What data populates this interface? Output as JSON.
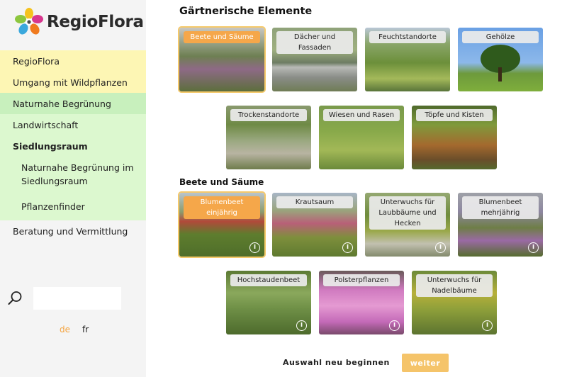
{
  "sidebar": {
    "logo_text": "RegioFlora",
    "nav": {
      "regioflora": "RegioFlora",
      "umgang": "Umgang mit Wildpflanzen",
      "naturnahe": "Naturnahe Begrünung",
      "landwirtschaft": "Landwirtschaft",
      "siedlungsraum": "Siedlungsraum",
      "sub": [
        "Naturnahe Begrünung im Siedlungsraum",
        "Pflanzenfinder"
      ],
      "beratung": "Beratung und Vermittlung"
    },
    "search_placeholder": "",
    "languages": [
      "de",
      "fr"
    ],
    "active_language": "de",
    "colors": {
      "accent": "#f5a542",
      "yellow": "#fdf6b4",
      "green": "#c8f0bd",
      "light_green": "#dcf8cf"
    }
  },
  "main": {
    "title": "Gärtnerische Elemente",
    "elements": [
      {
        "label": "Beete und Säume",
        "selected": true
      },
      {
        "label": "Dächer und Fassaden",
        "selected": false
      },
      {
        "label": "Feuchtstandorte",
        "selected": false
      },
      {
        "label": "Gehölze",
        "selected": false
      },
      {
        "label": "Trockenstandorte",
        "selected": false
      },
      {
        "label": "Wiesen und Rasen",
        "selected": false
      },
      {
        "label": "Töpfe und Kisten",
        "selected": false
      }
    ],
    "subtitle": "Beete und Säume",
    "subelements": [
      {
        "label": "Blumenbeet einjährig",
        "selected": true,
        "info_icon": true
      },
      {
        "label": "Krautsaum",
        "selected": false,
        "info_icon": true
      },
      {
        "label": "Unterwuchs für Laubbäume und Hecken",
        "selected": false,
        "info_icon": true
      },
      {
        "label": "Blumenbeet mehrjährig",
        "selected": false,
        "info_icon": true
      },
      {
        "label": "Hochstaudenbeet",
        "selected": false,
        "info_icon": true
      },
      {
        "label": "Polsterpflanzen",
        "selected": false,
        "info_icon": true
      },
      {
        "label": "Unterwuchs für Nadelbäume",
        "selected": false,
        "info_icon": true
      }
    ],
    "reset_label": "Auswahl neu beginnen",
    "next_label": "weiter",
    "info_glyph": "i"
  }
}
